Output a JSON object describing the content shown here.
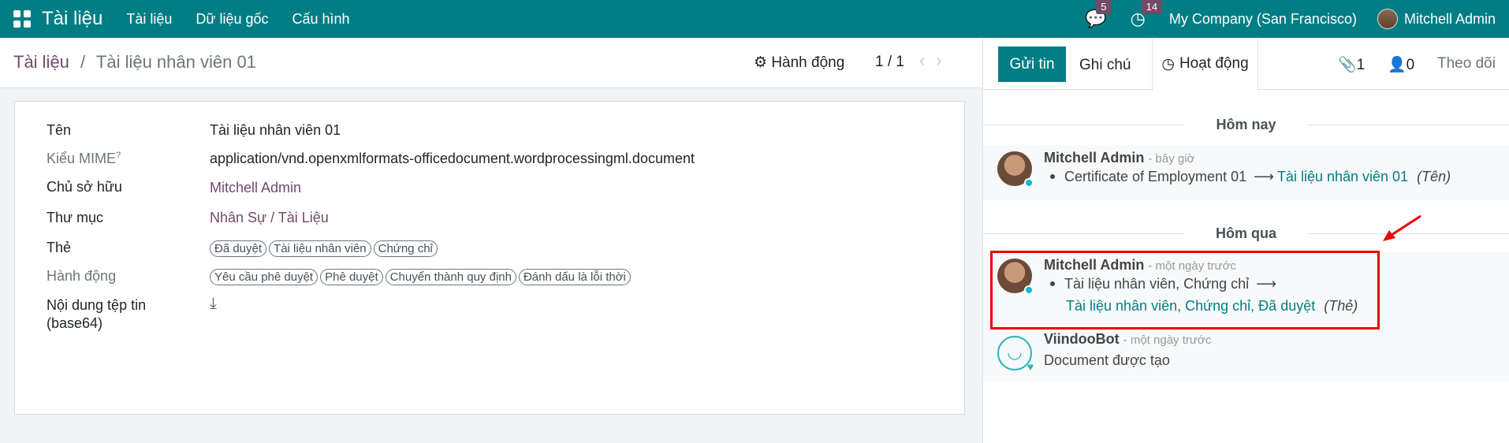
{
  "topbar": {
    "app_name": "Tài liệu",
    "menu": [
      "Tài liệu",
      "Dữ liệu gốc",
      "Cấu hình"
    ],
    "chat_badge": "5",
    "activity_badge": "14",
    "company": "My Company (San Francisco)",
    "user": "Mitchell Admin"
  },
  "control": {
    "breadcrumb_root": "Tài liệu",
    "breadcrumb_sep": "/",
    "breadcrumb_current": "Tài liệu nhân viên 01",
    "action": "Hành động",
    "pager": "1 / 1"
  },
  "form": {
    "name_label": "Tên",
    "name_value": "Tài liệu nhân viên 01",
    "mime_label": "Kiểu MIME",
    "mime_help": "?",
    "mime_value": "application/vnd.openxmlformats-officedocument.wordprocessingml.document",
    "owner_label": "Chủ sở hữu",
    "owner_value": "Mitchell Admin",
    "folder_label": "Thư mục",
    "folder_value": "Nhân Sự / Tài Liệu",
    "tags_label": "Thẻ",
    "tags": [
      "Đã duyệt",
      "Tài liệu nhân viên",
      "Chứng chỉ"
    ],
    "actions_label": "Hành động",
    "actions": [
      "Yêu cầu phê duyệt",
      "Phê duyệt",
      "Chuyển thành quy định",
      "Đánh dấu là lỗi thời"
    ],
    "content_label_1": "Nội dung tệp tin",
    "content_label_2": "(base64)"
  },
  "chatter": {
    "send": "Gửi tin",
    "note": "Ghi chú",
    "activity": "Hoạt động",
    "attachments": "1",
    "followers": "0",
    "follow": "Theo dõi",
    "today": "Hôm nay",
    "yesterday": "Hôm qua",
    "msg1": {
      "author": "Mitchell Admin",
      "time": "- bây giờ",
      "old": "Certificate of Employment 01",
      "new": "Tài liệu nhân viên 01",
      "field": "(Tên)"
    },
    "msg2": {
      "author": "Mitchell Admin",
      "time": "- một ngày trước",
      "old": "Tài liệu nhân viên, Chứng chỉ",
      "new": "Tài liệu nhân viên, Chứng chỉ, Đã duyệt",
      "field": "(Thẻ)"
    },
    "msg3": {
      "author": "ViindooBot",
      "time": "- một ngày trước",
      "body": "Document được tạo"
    }
  },
  "colors": {
    "brand": "#017e84",
    "link": "#714b67",
    "highlight": "#e00000"
  }
}
